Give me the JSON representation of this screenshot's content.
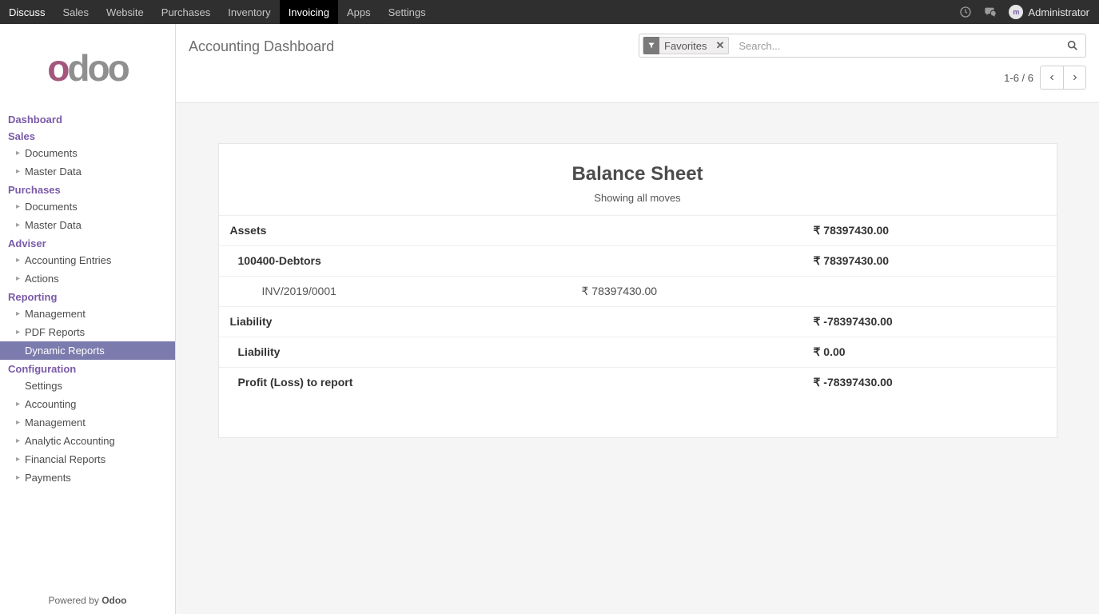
{
  "navbar": {
    "items": [
      "Discuss",
      "Sales",
      "Website",
      "Purchases",
      "Inventory",
      "Invoicing",
      "Apps",
      "Settings"
    ],
    "active_index": 5,
    "user": "Administrator"
  },
  "sidebar": {
    "logo": "odoo",
    "powered_prefix": "Powered by ",
    "powered_brand": "Odoo",
    "groups": [
      {
        "header": "Dashboard",
        "items": []
      },
      {
        "header": "Sales",
        "items": [
          {
            "label": "Documents",
            "caret": true
          },
          {
            "label": "Master Data",
            "caret": true
          }
        ]
      },
      {
        "header": "Purchases",
        "items": [
          {
            "label": "Documents",
            "caret": true
          },
          {
            "label": "Master Data",
            "caret": true
          }
        ]
      },
      {
        "header": "Adviser",
        "items": [
          {
            "label": "Accounting Entries",
            "caret": true
          },
          {
            "label": "Actions",
            "caret": true
          }
        ]
      },
      {
        "header": "Reporting",
        "items": [
          {
            "label": "Management",
            "caret": true
          },
          {
            "label": "PDF Reports",
            "caret": true
          },
          {
            "label": "Dynamic Reports",
            "caret": false,
            "active": true
          }
        ]
      },
      {
        "header": "Configuration",
        "items": [
          {
            "label": "Settings",
            "caret": false
          },
          {
            "label": "Accounting",
            "caret": true
          },
          {
            "label": "Management",
            "caret": true
          },
          {
            "label": "Analytic Accounting",
            "caret": true
          },
          {
            "label": "Financial Reports",
            "caret": true
          },
          {
            "label": "Payments",
            "caret": true
          }
        ]
      }
    ]
  },
  "main_header": {
    "title": "Accounting Dashboard",
    "facet_label": "Favorites",
    "search_placeholder": "Search...",
    "pager": "1-6 / 6"
  },
  "report": {
    "title": "Balance Sheet",
    "subtitle": "Showing all moves",
    "rows": [
      {
        "level": 0,
        "label": "Assets",
        "col3": "₹ 78397430.00"
      },
      {
        "level": 1,
        "label": "100400-Debtors",
        "col3": "₹ 78397430.00"
      },
      {
        "level": 2,
        "label": "INV/2019/0001",
        "col2": "₹ 78397430.00"
      },
      {
        "level": 0,
        "label": "Liability",
        "col3": "₹ -78397430.00"
      },
      {
        "level": 1,
        "label": "Liability",
        "col3": "₹ 0.00"
      },
      {
        "level": 1,
        "label": "Profit (Loss) to report",
        "col3": "₹ -78397430.00"
      }
    ]
  }
}
